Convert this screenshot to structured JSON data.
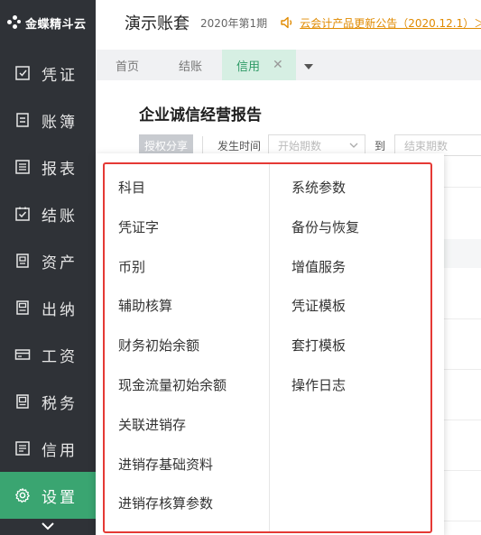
{
  "brand": {
    "name": "金蝶精斗云"
  },
  "sidebar": {
    "items": [
      {
        "label": "凭证",
        "icon": "voucher-icon"
      },
      {
        "label": "账簿",
        "icon": "ledger-icon"
      },
      {
        "label": "报表",
        "icon": "report-icon"
      },
      {
        "label": "结账",
        "icon": "checkout-icon"
      },
      {
        "label": "资产",
        "icon": "asset-icon"
      },
      {
        "label": "出纳",
        "icon": "cashier-icon"
      },
      {
        "label": "工资",
        "icon": "salary-icon"
      },
      {
        "label": "税务",
        "icon": "tax-icon"
      },
      {
        "label": "信用",
        "icon": "credit-icon"
      },
      {
        "label": "设置",
        "icon": "gear-icon",
        "active": true
      }
    ],
    "expand_icon": "chevron-down-icon"
  },
  "header": {
    "account_title": "演示账套",
    "period": "2020年第1期",
    "notice": "云会计产品更新公告（2020.12.1）＞"
  },
  "tabs": [
    {
      "label": "首页"
    },
    {
      "label": "结账"
    },
    {
      "label": "信用",
      "active": true,
      "closable": true
    }
  ],
  "main": {
    "title": "企业诚信经营报告",
    "auth_button": "授权分享",
    "date_label": "发生时间",
    "start_placeholder": "开始期数",
    "to_label": "到",
    "end_placeholder": "结束期数"
  },
  "settings_menu": {
    "left": [
      "科目",
      "凭证字",
      "币别",
      "辅助核算",
      "财务初始余额",
      "现金流量初始余额",
      "关联进销存",
      "进销存基础资料",
      "进销存核算参数"
    ],
    "right": [
      "系统参数",
      "备份与恢复",
      "增值服务",
      "凭证模板",
      "套打模板",
      "操作日志"
    ]
  },
  "colors": {
    "sidebar_bg": "#2f3237",
    "sidebar_active": "#3aa571",
    "tab_active_bg": "#d6efe3",
    "tab_active_text": "#2e9a66",
    "notice": "#e08a00",
    "highlight_border": "#e53935"
  }
}
